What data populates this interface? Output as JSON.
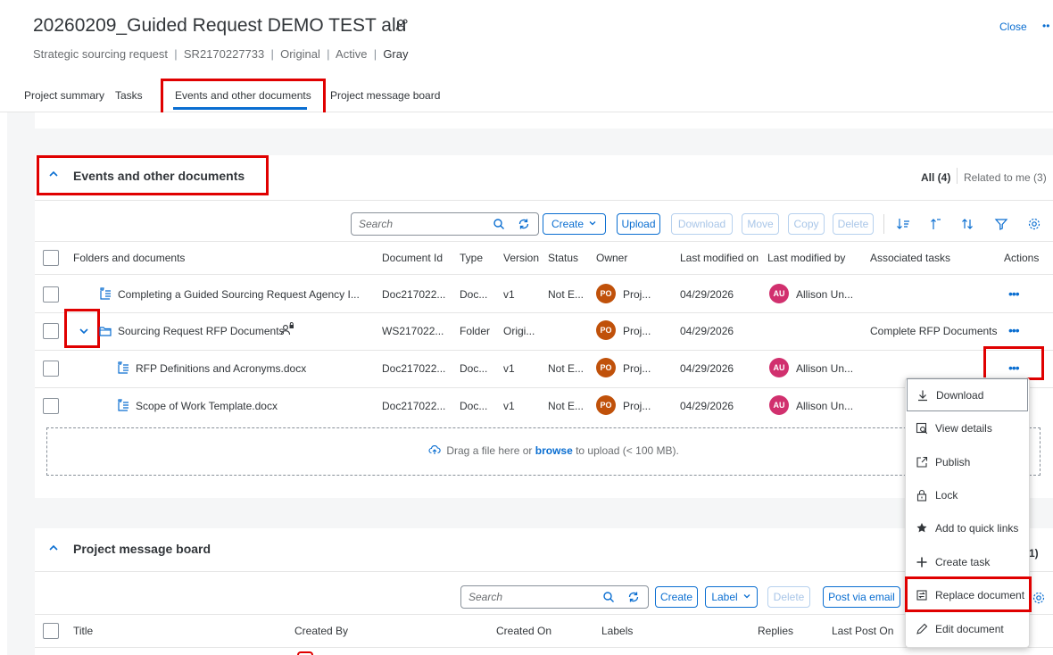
{
  "header": {
    "title": "20260209_Guided Request DEMO TEST alu",
    "subtitle_type": "Strategic sourcing request",
    "subtitle_id": "SR2170227733",
    "subtitle_version": "Original",
    "subtitle_status": "Active",
    "subtitle_owner": "Gray",
    "close_label": "Close",
    "more_label": "••"
  },
  "tabs": [
    {
      "label": "Project summary"
    },
    {
      "label": "Tasks"
    },
    {
      "label": "Events and other documents"
    },
    {
      "label": "Project message board"
    }
  ],
  "events_section": {
    "title": "Events and other documents",
    "filter_all": "All (4)",
    "filter_related": "Related to me (3)",
    "search_placeholder": "Search",
    "toolbar": {
      "create": "Create",
      "upload": "Upload",
      "download": "Download",
      "move": "Move",
      "copy": "Copy",
      "delete": "Delete"
    },
    "columns": [
      "Folders and documents",
      "Document Id",
      "Type",
      "Version",
      "Status",
      "Owner",
      "Last modified on",
      "Last modified by",
      "Associated tasks",
      "Actions"
    ],
    "rows": [
      {
        "name": "Completing a Guided Sourcing Request Agency I...",
        "doc_id": "Doc217022...",
        "type": "Doc...",
        "version": "v1",
        "status": "Not E...",
        "owner_initials": "PO",
        "owner": "Proj...",
        "modified_on": "04/29/2026",
        "modifier_initials": "AU",
        "modified_by": "Allison Un...",
        "task": "",
        "actions": "•••"
      },
      {
        "name": "Sourcing Request RFP Documents",
        "doc_id": "WS217022...",
        "type": "Folder",
        "version": "Origi...",
        "status": "",
        "owner_initials": "PO",
        "owner": "Proj...",
        "modified_on": "04/29/2026",
        "modifier_initials": "",
        "modified_by": "",
        "task": "Complete RFP Documents",
        "actions": "•••"
      },
      {
        "name": "RFP Definitions and Acronyms.docx",
        "doc_id": "Doc217022...",
        "type": "Doc...",
        "version": "v1",
        "status": "Not E...",
        "owner_initials": "PO",
        "owner": "Proj...",
        "modified_on": "04/29/2026",
        "modifier_initials": "AU",
        "modified_by": "Allison Un...",
        "task": "",
        "actions": "•••"
      },
      {
        "name": "Scope of Work Template.docx",
        "doc_id": "Doc217022...",
        "type": "Doc...",
        "version": "v1",
        "status": "Not E...",
        "owner_initials": "PO",
        "owner": "Proj...",
        "modified_on": "04/29/2026",
        "modifier_initials": "AU",
        "modified_by": "Allison Un...",
        "task": "",
        "actions": ""
      }
    ],
    "dropzone_pre": "Drag a file here or ",
    "dropzone_link": "browse",
    "dropzone_post": " to upload (< 100 MB)."
  },
  "context_menu": {
    "items": [
      {
        "label": "Download",
        "icon": "download-icon"
      },
      {
        "label": "View details",
        "icon": "view-details-icon"
      },
      {
        "label": "Publish",
        "icon": "publish-icon"
      },
      {
        "label": "Lock",
        "icon": "lock-icon"
      },
      {
        "label": "Add to quick links",
        "icon": "star-icon"
      },
      {
        "label": "Create task",
        "icon": "plus-icon"
      },
      {
        "label": "Replace document",
        "icon": "replace-icon"
      },
      {
        "label": "Edit document",
        "icon": "edit-icon"
      }
    ]
  },
  "message_board": {
    "title": "Project message board",
    "count_fragment": "1)",
    "search_placeholder": "Search",
    "toolbar": {
      "create": "Create",
      "label": "Label",
      "delete": "Delete",
      "post_via_email": "Post via email"
    },
    "columns": [
      "Title",
      "Created By",
      "Created On",
      "Labels",
      "Replies",
      "Last Post On"
    ]
  },
  "colors": {
    "accent": "#0a6ed1",
    "highlight": "#e00000",
    "owner_avatar": "#c0510a",
    "modifier_avatar": "#d1306e"
  }
}
